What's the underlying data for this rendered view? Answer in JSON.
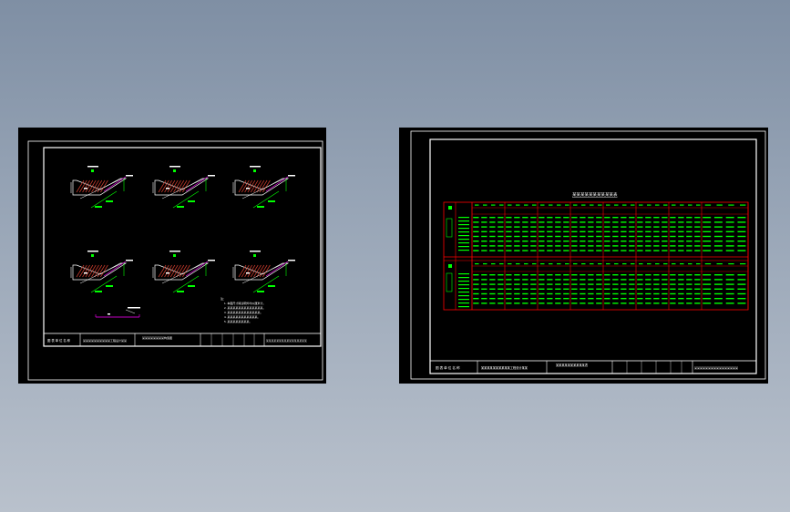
{
  "colors": {
    "background_top": "#7f8fa4",
    "background_bottom": "#b9c1cc",
    "sheet": "#000000",
    "frame": "#ffffff",
    "hatch": "#c0392b",
    "dimension": "#00ff00",
    "annotation": "#ff00ff",
    "table_border": "#ff0000",
    "table_text": "#00ff00"
  },
  "left_sheet": {
    "title_block": {
      "cell_1": "图 表 单 位 名 称",
      "cell_2": "某某某某某某某某某某工程设计某某",
      "cell_3": "某某某某某某某某构造图",
      "cell_4": "某某某某某某某某某某某某某某某某"
    },
    "notes": [
      "注：",
      "1. 本图尺寸除注明外均以厘米计。",
      "2. 某某某某某某某某某某某某某。",
      "3. 某某某某某某某某某某某某。",
      "4. 某某某某某某某某某某某。",
      "5. 某某某某某某某某。"
    ]
  },
  "right_sheet": {
    "table_title": "某某某某某某某某某某表",
    "title_block": {
      "cell_1": "图 表 单 位 名 称",
      "cell_2": "某某某某某某某某某某工程设计某某",
      "cell_3": "某某某某某某某某某某表",
      "cell_4": "某某某某某某某某某某某某某某某某"
    }
  }
}
